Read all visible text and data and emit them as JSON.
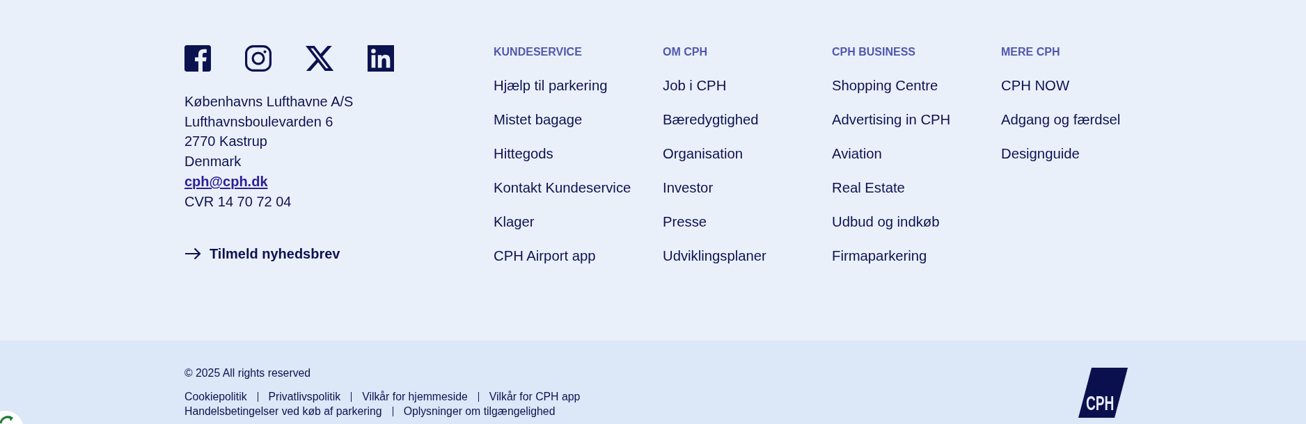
{
  "social_links": [
    {
      "kind": "facebook"
    },
    {
      "kind": "instagram"
    },
    {
      "kind": "x"
    },
    {
      "kind": "linkedin"
    }
  ],
  "contact": {
    "address_lines": [
      "Københavns Lufthavne A/S",
      "Lufthavnsboulevarden 6",
      "2770 Kastrup",
      "Denmark"
    ],
    "email": "cph@cph.dk",
    "cvr": "CVR 14 70 72 04"
  },
  "newsletter": {
    "label": "Tilmeld nyhedsbrev"
  },
  "link_columns": [
    {
      "heading": "KUNDESERVICE",
      "links": [
        "Hjælp til parkering",
        "Mistet bagage",
        "Hittegods",
        "Kontakt Kundeservice",
        "Klager",
        "CPH Airport app"
      ]
    },
    {
      "heading": "OM CPH",
      "links": [
        "Job i CPH",
        "Bæredygtighed",
        "Organisation",
        "Investor",
        "Presse",
        "Udviklingsplaner"
      ]
    },
    {
      "heading": "CPH BUSINESS",
      "links": [
        "Shopping Centre",
        "Advertising in CPH",
        "Aviation",
        "Real Estate",
        "Udbud og indkøb",
        "Firmaparkering"
      ]
    },
    {
      "heading": "MERE CPH",
      "links": [
        "CPH NOW",
        "Adgang og færdsel",
        "Designguide"
      ]
    }
  ],
  "bottom_bar": {
    "copyright": "© 2025 All rights reserved",
    "legal_link_rows": [
      {
        "links": [
          "Cookiepolitik",
          "Privatlivspolitik",
          "Vilkår for hjemmeside",
          "Vilkår for CPH app"
        ]
      },
      {
        "links": [
          "Handelsbetingelser ved køb af parkering",
          "Oplysninger om tilgængelighed"
        ]
      }
    ],
    "logo": {
      "text": "CPH"
    }
  }
}
